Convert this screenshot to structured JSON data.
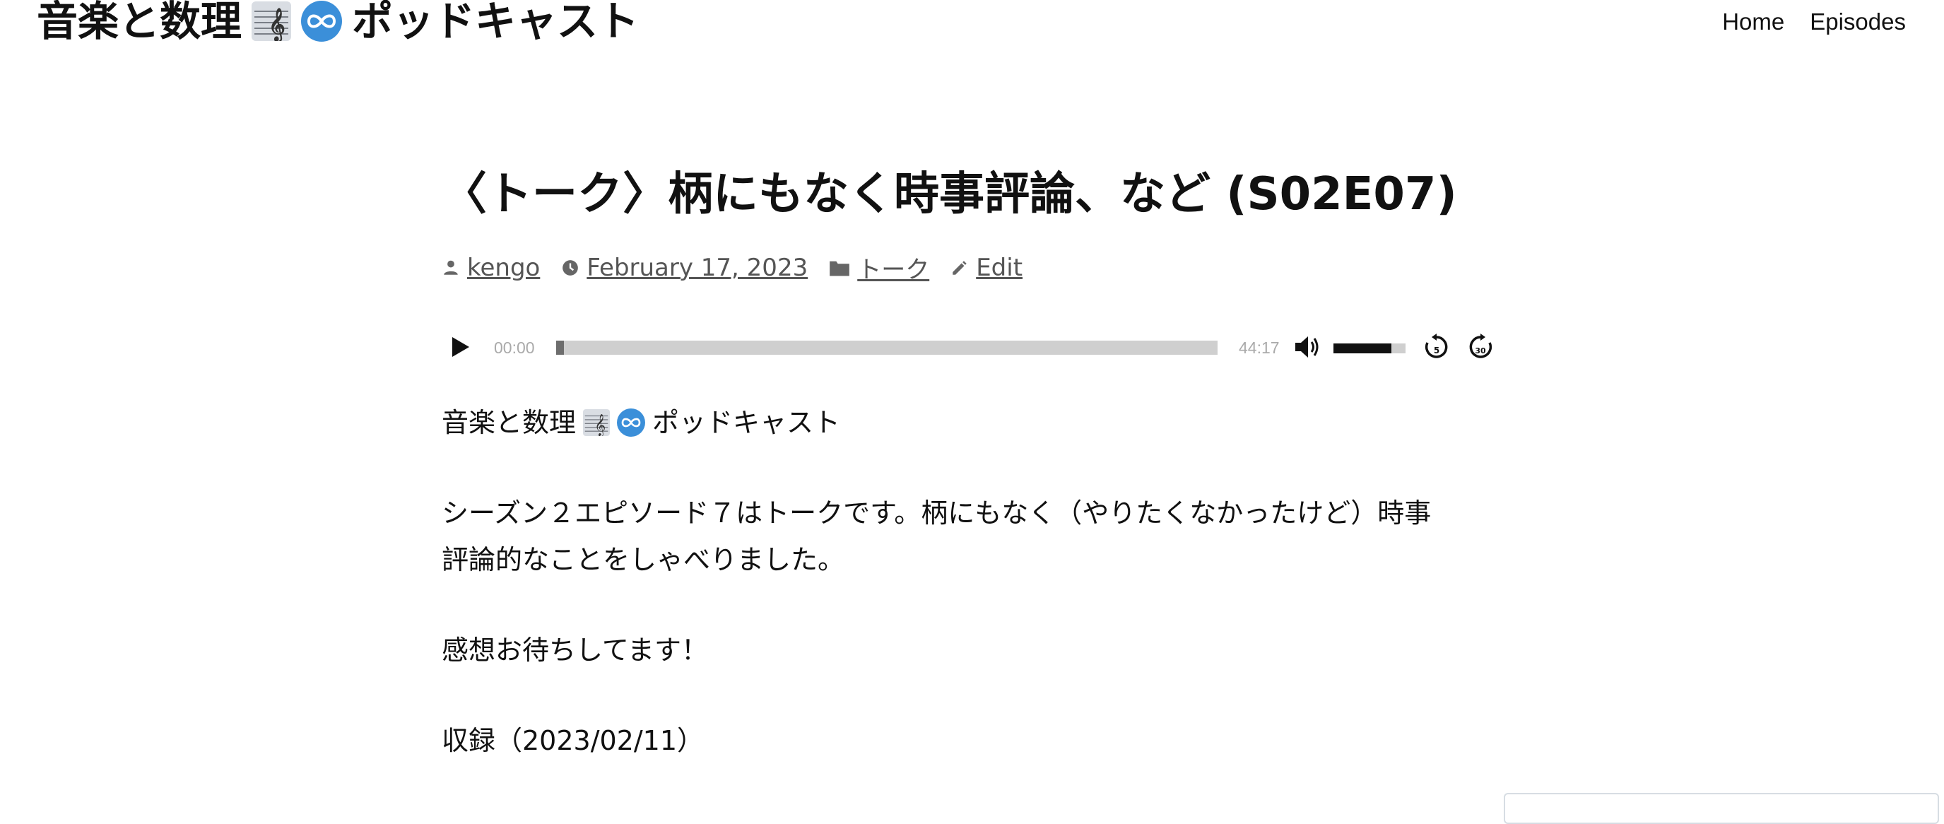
{
  "header": {
    "site_title_prefix": "音楽と数理",
    "site_title_suffix": "ポッドキャスト",
    "nav": [
      {
        "label": "Home"
      },
      {
        "label": "Episodes"
      }
    ]
  },
  "entry": {
    "title": "〈トーク〉柄にもなく時事評論、など (S02E07)",
    "meta": {
      "author": "kengo",
      "date": "February 17, 2023",
      "category": "トーク",
      "edit": "Edit"
    }
  },
  "player": {
    "current_time": "00:00",
    "total_time": "44:17",
    "progress": 0.012,
    "volume": 0.8,
    "skip_back_seconds": "5",
    "skip_forward_seconds": "30"
  },
  "content": {
    "podcast_name_prefix": "音楽と数理",
    "podcast_name_suffix": "ポッドキャスト",
    "paragraph_1_line_1": "シーズン２エピソード７はトークです。柄にもなく（やりたくなかったけど）時事",
    "paragraph_1_line_2": "評論的なことをしゃべりました。",
    "paragraph_2": "感想お待ちしてます！",
    "paragraph_3": "収録（2023/02/11）"
  },
  "icons": {
    "staff_emoji": "musical-score-icon",
    "infinity_emoji": "infinity-icon",
    "author": "person-icon",
    "date": "clock-icon",
    "category": "folder-icon",
    "edit": "pencil-icon"
  },
  "colors": {
    "infinity_badge": "#3b8fd9",
    "meta_text": "#555555",
    "player_time": "#aaaaaa"
  }
}
